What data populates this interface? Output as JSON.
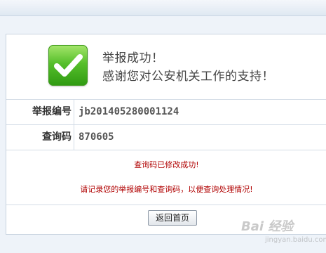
{
  "result": {
    "icon": "checkmark-icon",
    "title": "举报成功！",
    "subtitle": "感谢您对公安机关工作的支持！",
    "accent_color": "#56bf2b"
  },
  "details": [
    {
      "label": "举报编号",
      "value": "jb201405280001124"
    },
    {
      "label": "查询码",
      "value": "870605"
    }
  ],
  "notices": {
    "modified": "查询码已修改成功!",
    "reminder": "请记录您的举报编号和查询码，以便查询处理情况!",
    "color": "#b00000"
  },
  "actions": {
    "back_home_label": "返回首页"
  },
  "watermark": {
    "logo": "Bai 经验",
    "sub": "jingyan.baidu.com"
  }
}
